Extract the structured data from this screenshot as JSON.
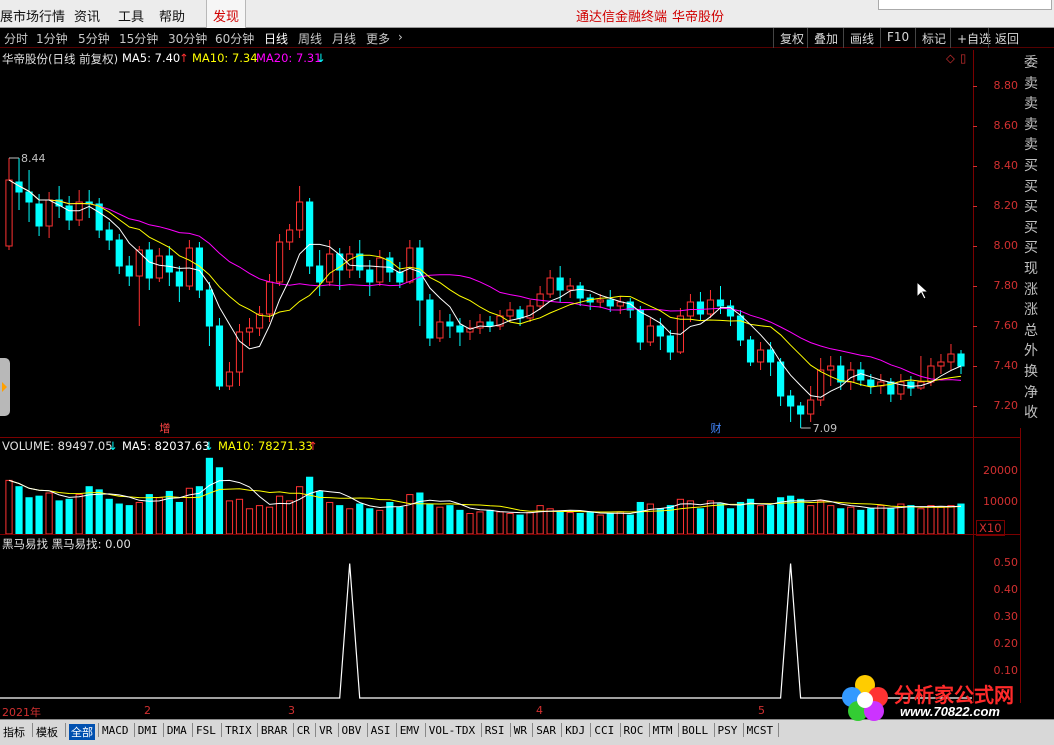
{
  "menubar": {
    "items": [
      "展市场行情",
      "资讯",
      "工具",
      "帮助"
    ],
    "discover": "发现",
    "brand_title": "通达信金融终端",
    "brand_stock": "华帝股份"
  },
  "toolbar": {
    "periods": [
      "分时",
      "1分钟",
      "5分钟",
      "15分钟",
      "30分钟",
      "60分钟",
      "日线",
      "周线",
      "月线",
      "更多"
    ],
    "active_period": "日线",
    "more_arrow": "›",
    "right_buttons": [
      "复权",
      "叠加",
      "画线",
      "F10",
      "标记",
      "+自选",
      "返回"
    ]
  },
  "main_chart": {
    "header_name": "华帝股份(日线 前复权)",
    "ma5": "MA5: 7.40",
    "ma10": "MA10: 7.34",
    "ma20": "MA20: 7.31",
    "ma5_arrow": "↑",
    "ma10_arrow": "↑",
    "ma20_arrow": "↓",
    "high_label": "8.44",
    "low_label": "7.09",
    "marker_zeng": "增",
    "marker_cai": "财",
    "y_ticks": [
      "8.80",
      "8.60",
      "8.40",
      "8.20",
      "8.00",
      "7.80",
      "7.60",
      "7.40",
      "7.20"
    ],
    "colors": {
      "up": "#ff3232",
      "down": "#00ffff",
      "ma5": "#ffffff",
      "ma10": "#ffff00",
      "ma20": "#ff00ff",
      "axis": "#d23030"
    }
  },
  "volume_chart": {
    "volume": "VOLUME: 89497.05",
    "volume_arrow": "↓",
    "ma5": "MA5: 82037.63",
    "ma5_arrow": "↓",
    "ma10": "MA10: 78271.33",
    "ma10_arrow": "↑",
    "y_ticks": [
      "20000",
      "10000"
    ],
    "unit": "X10"
  },
  "indicator": {
    "header": "黑马易找  黑马易找: 0.00",
    "y_ticks": [
      "0.50",
      "0.40",
      "0.30",
      "0.20",
      "0.10"
    ]
  },
  "side_panel": [
    "委",
    "卖",
    "卖",
    "卖",
    "卖",
    "买",
    "买",
    "买",
    "买",
    "买",
    "现",
    "涨",
    "涨",
    "总",
    "外",
    "换",
    "净",
    "收"
  ],
  "date_axis": [
    "2021年",
    "2",
    "3",
    "4",
    "5"
  ],
  "bottom_tabs": [
    "指标",
    "模板",
    "全部",
    "MACD",
    "DMI",
    "DMA",
    "FSL",
    "TRIX",
    "BRAR",
    "CR",
    "VR",
    "OBV",
    "ASI",
    "EMV",
    "VOL-TDX",
    "RSI",
    "WR",
    "SAR",
    "KDJ",
    "CCI",
    "ROC",
    "MTM",
    "BOLL",
    "PSY",
    "MCST"
  ],
  "bottom_selected": "全部",
  "logo": {
    "title": "分析家公式网",
    "url": "www.70822.com"
  },
  "chart_data": {
    "type": "candlestick",
    "title": "华帝股份(日线 前复权)",
    "price_range": [
      7.05,
      8.9
    ],
    "candles": [
      [
        8.0,
        8.33,
        8.44,
        7.98
      ],
      [
        8.32,
        8.27,
        8.44,
        8.18
      ],
      [
        8.27,
        8.22,
        8.38,
        8.12
      ],
      [
        8.21,
        8.1,
        8.26,
        8.05
      ],
      [
        8.1,
        8.23,
        8.27,
        8.04
      ],
      [
        8.23,
        8.2,
        8.3,
        8.14
      ],
      [
        8.2,
        8.13,
        8.25,
        8.08
      ],
      [
        8.13,
        8.22,
        8.28,
        8.1
      ],
      [
        8.22,
        8.21,
        8.28,
        8.14
      ],
      [
        8.21,
        8.08,
        8.24,
        8.04
      ],
      [
        8.08,
        8.03,
        8.12,
        7.98
      ],
      [
        8.03,
        7.9,
        8.06,
        7.86
      ],
      [
        7.9,
        7.85,
        7.95,
        7.8
      ],
      [
        7.85,
        7.98,
        8.0,
        7.6
      ],
      [
        7.98,
        7.84,
        8.02,
        7.78
      ],
      [
        7.84,
        7.95,
        7.99,
        7.82
      ],
      [
        7.95,
        7.87,
        8.0,
        7.8
      ],
      [
        7.87,
        7.8,
        7.9,
        7.72
      ],
      [
        7.8,
        7.99,
        8.03,
        7.78
      ],
      [
        7.99,
        7.78,
        8.02,
        7.74
      ],
      [
        7.78,
        7.6,
        7.82,
        7.5
      ],
      [
        7.6,
        7.3,
        7.64,
        7.28
      ],
      [
        7.3,
        7.37,
        7.42,
        7.28
      ],
      [
        7.37,
        7.57,
        7.61,
        7.3
      ],
      [
        7.57,
        7.59,
        7.64,
        7.5
      ],
      [
        7.59,
        7.66,
        7.7,
        7.55
      ],
      [
        7.66,
        7.82,
        7.86,
        7.62
      ],
      [
        7.82,
        8.02,
        8.06,
        7.8
      ],
      [
        8.02,
        8.08,
        8.11,
        7.98
      ],
      [
        8.08,
        8.22,
        8.3,
        8.04
      ],
      [
        8.22,
        7.9,
        8.24,
        7.86
      ],
      [
        7.9,
        7.82,
        7.98,
        7.75
      ],
      [
        7.82,
        7.96,
        8.03,
        7.8
      ],
      [
        7.96,
        7.88,
        7.99,
        7.78
      ],
      [
        7.88,
        7.96,
        8.0,
        7.84
      ],
      [
        7.96,
        7.88,
        8.03,
        7.84
      ],
      [
        7.88,
        7.82,
        7.93,
        7.75
      ],
      [
        7.82,
        7.94,
        7.98,
        7.8
      ],
      [
        7.94,
        7.87,
        7.97,
        7.82
      ],
      [
        7.87,
        7.82,
        7.92,
        7.79
      ],
      [
        7.82,
        7.99,
        8.03,
        7.81
      ],
      [
        7.99,
        7.73,
        8.03,
        7.6
      ],
      [
        7.73,
        7.54,
        7.76,
        7.5
      ],
      [
        7.54,
        7.62,
        7.68,
        7.52
      ],
      [
        7.62,
        7.6,
        7.66,
        7.54
      ],
      [
        7.6,
        7.57,
        7.64,
        7.5
      ],
      [
        7.57,
        7.59,
        7.63,
        7.53
      ],
      [
        7.59,
        7.62,
        7.66,
        7.56
      ],
      [
        7.62,
        7.6,
        7.65,
        7.57
      ],
      [
        7.6,
        7.65,
        7.68,
        7.58
      ],
      [
        7.65,
        7.68,
        7.72,
        7.62
      ],
      [
        7.68,
        7.64,
        7.7,
        7.6
      ],
      [
        7.64,
        7.7,
        7.73,
        7.62
      ],
      [
        7.7,
        7.76,
        7.8,
        7.68
      ],
      [
        7.76,
        7.84,
        7.88,
        7.74
      ],
      [
        7.84,
        7.78,
        7.9,
        7.72
      ],
      [
        7.78,
        7.8,
        7.84,
        7.74
      ],
      [
        7.8,
        7.74,
        7.82,
        7.7
      ],
      [
        7.74,
        7.72,
        7.76,
        7.68
      ],
      [
        7.72,
        7.73,
        7.76,
        7.69
      ],
      [
        7.73,
        7.7,
        7.78,
        7.67
      ],
      [
        7.7,
        7.72,
        7.75,
        7.66
      ],
      [
        7.72,
        7.68,
        7.74,
        7.64
      ],
      [
        7.68,
        7.52,
        7.7,
        7.48
      ],
      [
        7.52,
        7.6,
        7.64,
        7.5
      ],
      [
        7.6,
        7.55,
        7.64,
        7.48
      ],
      [
        7.55,
        7.47,
        7.58,
        7.43
      ],
      [
        7.47,
        7.65,
        7.69,
        7.46
      ],
      [
        7.65,
        7.72,
        7.76,
        7.62
      ],
      [
        7.72,
        7.66,
        7.77,
        7.63
      ],
      [
        7.66,
        7.73,
        7.78,
        7.64
      ],
      [
        7.73,
        7.7,
        7.8,
        7.66
      ],
      [
        7.7,
        7.65,
        7.73,
        7.6
      ],
      [
        7.65,
        7.53,
        7.68,
        7.5
      ],
      [
        7.53,
        7.42,
        7.55,
        7.4
      ],
      [
        7.42,
        7.48,
        7.52,
        7.38
      ],
      [
        7.48,
        7.42,
        7.52,
        7.35
      ],
      [
        7.42,
        7.25,
        7.44,
        7.2
      ],
      [
        7.25,
        7.2,
        7.28,
        7.12
      ],
      [
        7.2,
        7.16,
        7.22,
        7.09
      ],
      [
        7.16,
        7.23,
        7.3,
        7.12
      ],
      [
        7.23,
        7.38,
        7.44,
        7.2
      ],
      [
        7.38,
        7.4,
        7.45,
        7.3
      ],
      [
        7.4,
        7.32,
        7.45,
        7.28
      ],
      [
        7.32,
        7.38,
        7.42,
        7.28
      ],
      [
        7.38,
        7.33,
        7.42,
        7.3
      ],
      [
        7.33,
        7.3,
        7.36,
        7.26
      ],
      [
        7.3,
        7.32,
        7.36,
        7.26
      ],
      [
        7.32,
        7.26,
        7.34,
        7.22
      ],
      [
        7.26,
        7.32,
        7.36,
        7.23
      ],
      [
        7.32,
        7.29,
        7.35,
        7.25
      ],
      [
        7.29,
        7.32,
        7.45,
        7.28
      ],
      [
        7.32,
        7.4,
        7.44,
        7.3
      ],
      [
        7.4,
        7.42,
        7.46,
        7.36
      ],
      [
        7.42,
        7.46,
        7.51,
        7.38
      ],
      [
        7.46,
        7.4,
        7.48,
        7.36
      ]
    ],
    "volume_range": [
      0,
      26000
    ],
    "volumes": [
      17000,
      15000,
      11500,
      12000,
      13000,
      10500,
      11000,
      12500,
      15000,
      14000,
      11000,
      9500,
      9000,
      10000,
      12500,
      11500,
      13500,
      10000,
      14500,
      15000,
      24000,
      21000,
      10500,
      11000,
      8000,
      9000,
      8500,
      12000,
      10500,
      15000,
      18000,
      13500,
      10000,
      9000,
      8000,
      9500,
      8000,
      7500,
      10000,
      8500,
      12500,
      13000,
      9500,
      8500,
      9000,
      7500,
      6500,
      7000,
      7500,
      7000,
      6500,
      6000,
      6800,
      9000,
      8000,
      7000,
      6800,
      6500,
      7000,
      6000,
      6500,
      7000,
      6000,
      10000,
      9500,
      8000,
      9000,
      11000,
      10500,
      8000,
      10500,
      9500,
      8000,
      10000,
      11000,
      9000,
      9000,
      11500,
      12000,
      11000,
      9000,
      10500,
      9000,
      8000,
      8500,
      7500,
      8000,
      9000,
      8000,
      9500,
      9000,
      8000,
      9000,
      8500,
      9000,
      9500
    ],
    "indicator_range": [
      0,
      0.55
    ],
    "indicator_spikes": [
      {
        "index": 34,
        "value": 0.5
      },
      {
        "index": 78,
        "value": 0.5
      }
    ]
  }
}
